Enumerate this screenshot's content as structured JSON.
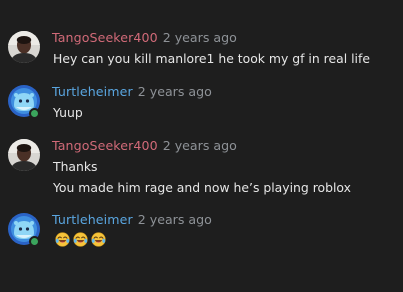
{
  "colors": {
    "background": "#1e1e1e",
    "user_tango": "#d16a78",
    "user_turtle": "#5aa6e0",
    "timestamp": "#8e9297",
    "text": "#e6e6e6",
    "online": "#3ba55d"
  },
  "messages": [
    {
      "author": "TangoSeeker400",
      "time": "2 years ago",
      "lines": [
        "Hey can you kill manlore1 he took my gf in real life"
      ],
      "avatar_icon": "user-photo-avatar-icon"
    },
    {
      "author": "Turtleheimer",
      "time": "2 years ago",
      "lines": [
        "Yuup"
      ],
      "avatar_icon": "blue-mascot-avatar-icon"
    },
    {
      "author": "TangoSeeker400",
      "time": "2 years ago",
      "lines": [
        "Thanks",
        "You made him rage and now he’s playing roblox"
      ],
      "avatar_icon": "user-photo-avatar-icon"
    },
    {
      "author": "Turtleheimer",
      "time": "2 years ago",
      "emojis": [
        "rolling-on-floor-laughing-emoji",
        "rolling-on-floor-laughing-emoji",
        "rolling-on-floor-laughing-emoji"
      ],
      "avatar_icon": "blue-mascot-avatar-icon"
    }
  ]
}
